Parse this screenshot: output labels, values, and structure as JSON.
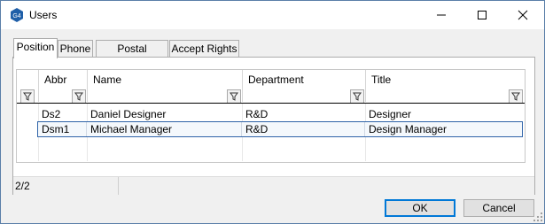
{
  "window": {
    "title": "Users",
    "app_icon_text": "G4"
  },
  "tabs": [
    {
      "label": "Position",
      "active": true
    },
    {
      "label": "Phone",
      "active": false
    },
    {
      "label": "Postal Address",
      "active": false
    },
    {
      "label": "Accept Rights",
      "active": false
    }
  ],
  "grid": {
    "columns": [
      "Abbr",
      "Name",
      "Department",
      "Title"
    ],
    "rows": [
      {
        "abbr": "Ds2",
        "name": "Daniel Designer",
        "department": "R&D",
        "title": "Designer",
        "selected": false
      },
      {
        "abbr": "Dsm1",
        "name": "Michael Manager",
        "department": "R&D",
        "title": "Design Manager",
        "selected": true
      }
    ]
  },
  "status": {
    "record_count": "2/2"
  },
  "buttons": {
    "ok": "OK",
    "cancel": "Cancel"
  },
  "icons": [
    "app-icon",
    "minimize-icon",
    "maximize-icon",
    "close-icon",
    "filter-icon",
    "resize-grip-icon"
  ],
  "colors": {
    "selection_border": "#2f63a8",
    "default_button_border": "#0078d7",
    "window_background": "#f0f0f0"
  }
}
